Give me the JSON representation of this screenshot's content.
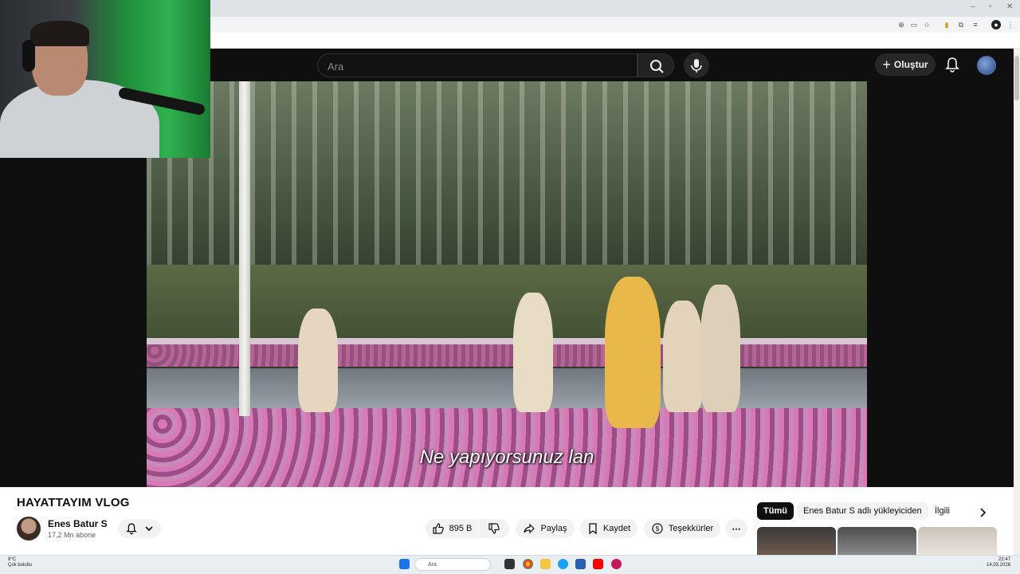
{
  "browser": {
    "window_controls": [
      "–",
      "▫",
      "✕"
    ],
    "extensions": [
      "zoom-icon",
      "cast-icon",
      "star-icon",
      "extension-icon",
      "profile-icon"
    ]
  },
  "header": {
    "search_placeholder": "Ara",
    "create_label": "Oluştur"
  },
  "video": {
    "subtitle": "Ne yapıyorsunuz lan"
  },
  "details": {
    "title": "HAYATTAYIM VLOG",
    "channel_name": "Enes Batur S",
    "subscribers": "17,2 Mn abone",
    "like_count": "895 B",
    "share_label": "Paylaş",
    "save_label": "Kaydet",
    "thanks_label": "Teşekkürler"
  },
  "chips": {
    "all": "Tümü",
    "uploads": "Enes Batur S adlı yükleyiciden",
    "related": "İlgili"
  },
  "taskbar": {
    "weather_temp": "8°C",
    "weather_desc": "Çok bulutlu",
    "search_placeholder": "Ara",
    "time": "22:47",
    "date": "14.03.2026"
  },
  "colors": {
    "yt_dark": "#0f0f0f",
    "chip_active": "#0f0f0f",
    "pill_bg": "#f2f2f2"
  }
}
